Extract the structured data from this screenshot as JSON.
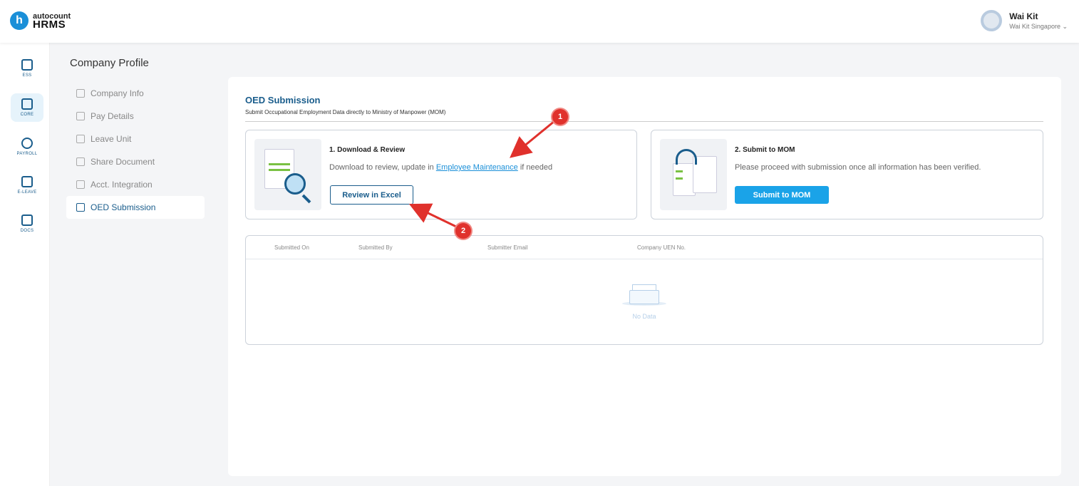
{
  "app": {
    "logo_mark": "h",
    "logo_top": "autocount",
    "logo_bottom": "HRMS"
  },
  "user": {
    "name": "Wai Kit",
    "company": "Wai Kit Singapore ⌄"
  },
  "rail": {
    "items": [
      {
        "label": "ESS",
        "icon": "calendar-user-icon"
      },
      {
        "label": "CORE",
        "icon": "cube-icon"
      },
      {
        "label": "PAYROLL",
        "icon": "dollar-icon"
      },
      {
        "label": "E-LEAVE",
        "icon": "calendar-grid-icon"
      },
      {
        "label": "DOCS",
        "icon": "document-chart-icon"
      }
    ]
  },
  "sidebar": {
    "title": "Company Profile",
    "items": [
      {
        "label": "Company Info"
      },
      {
        "label": "Pay Details"
      },
      {
        "label": "Leave Unit"
      },
      {
        "label": "Share Document"
      },
      {
        "label": "Acct. Integration"
      },
      {
        "label": "OED Submission"
      }
    ]
  },
  "main": {
    "title": "OED Submission",
    "subtitle": "Submit Occupational Employment Data directly to Ministry of Manpower (MOM)",
    "card1": {
      "title": "1. Download & Review",
      "desc_before": "Download to review, update in ",
      "desc_link": "Employee Maintenance",
      "desc_after": " if needed",
      "button": "Review in Excel"
    },
    "card2": {
      "title": "2. Submit to MOM",
      "desc": "Please proceed with submission once all information has been verified.",
      "button": "Submit to MOM"
    },
    "table": {
      "columns": [
        "Submitted On",
        "Submitted By",
        "Submitter Email",
        "Company UEN No."
      ],
      "empty_text": "No Data"
    }
  },
  "annotations": {
    "one": "1",
    "two": "2"
  }
}
